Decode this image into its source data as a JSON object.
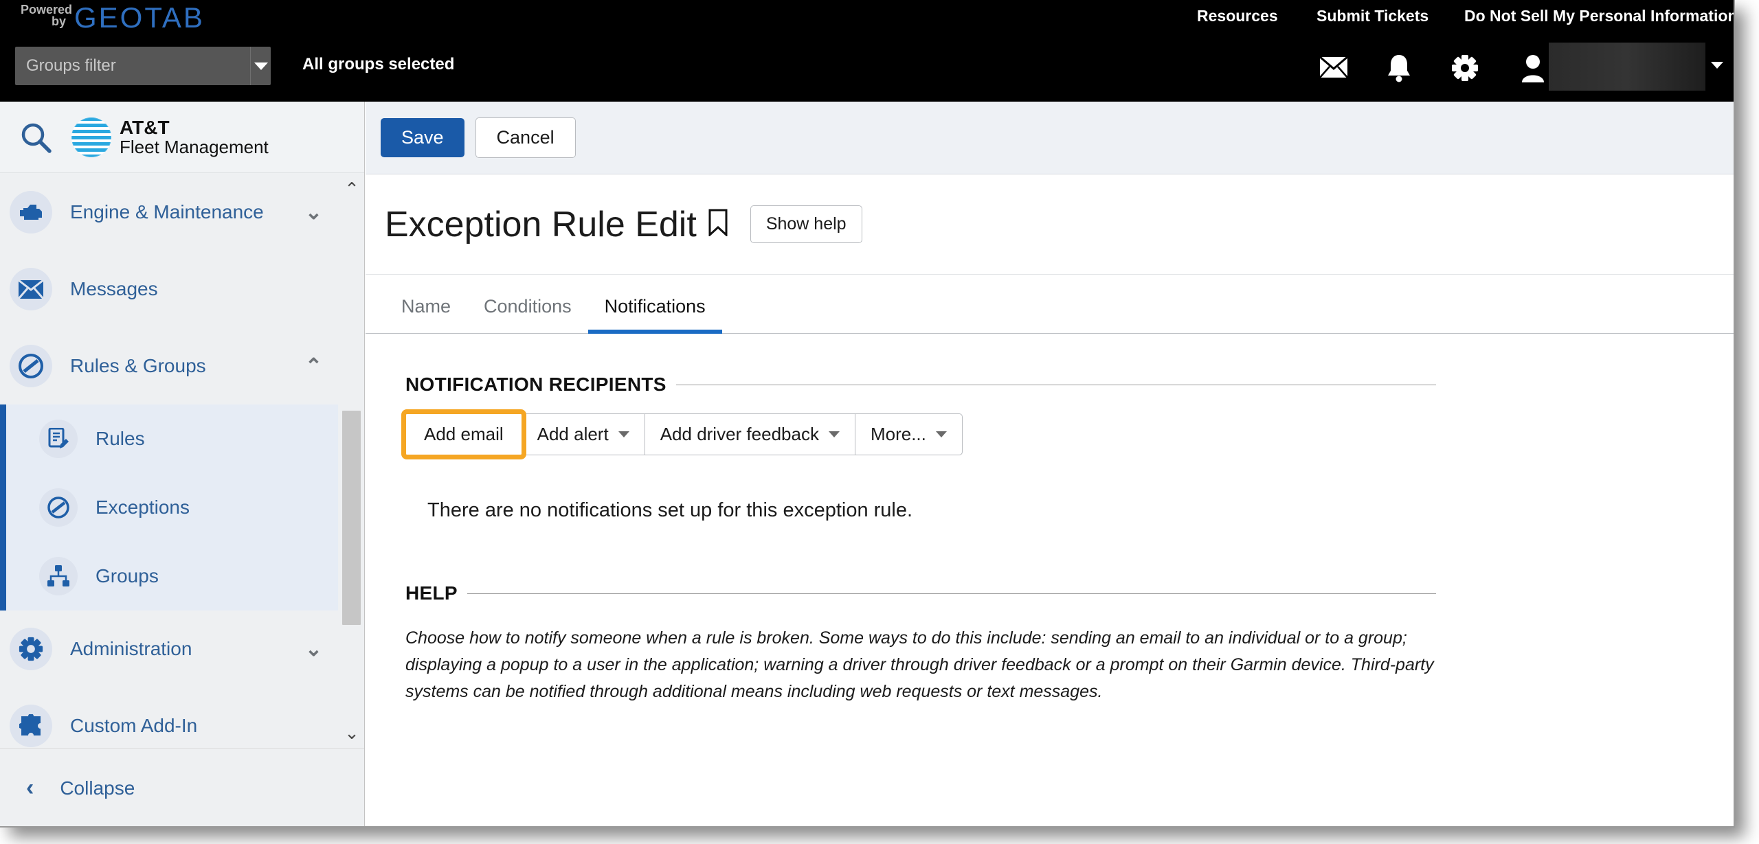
{
  "topbar": {
    "powered_by": "Powered by",
    "brand": "GEOTAB",
    "links": [
      {
        "label": "Resources"
      },
      {
        "label": "Submit Tickets"
      },
      {
        "label": "Do Not Sell My Personal Information"
      }
    ],
    "groups_filter_placeholder": "Groups filter",
    "groups_filter_value": "",
    "groups_status": "All groups selected",
    "icons": {
      "mail": "✉",
      "bell": "🔔",
      "gear": "✷",
      "user": "👤"
    },
    "user_name_redacted": ""
  },
  "sidebar": {
    "search_icon": "search-icon",
    "logo": {
      "name": "AT&T",
      "subtitle": "Fleet Management"
    },
    "items": [
      {
        "label": "Engine & Maintenance",
        "icon": "engine-icon",
        "chevron": "⌄"
      },
      {
        "label": "Messages",
        "icon": "envelope-icon",
        "chevron": ""
      },
      {
        "label": "Rules & Groups",
        "icon": "no-entry-icon",
        "chevron": "⌃"
      }
    ],
    "sub_items": [
      {
        "label": "Rules",
        "icon": "document-edit-icon"
      },
      {
        "label": "Exceptions",
        "icon": "no-entry-icon"
      },
      {
        "label": "Groups",
        "icon": "org-tree-icon"
      }
    ],
    "items_after": [
      {
        "label": "Administration",
        "icon": "gear-icon",
        "chevron": "⌄"
      },
      {
        "label": "Custom Add-In",
        "icon": "puzzle-icon",
        "chevron": ""
      }
    ],
    "collapse_label": "Collapse",
    "scroll_up": "⌃",
    "scroll_down": "⌄"
  },
  "main": {
    "save_label": "Save",
    "cancel_label": "Cancel",
    "page_title": "Exception Rule Edit",
    "show_help_label": "Show help",
    "tabs": [
      {
        "label": "Name",
        "active": false
      },
      {
        "label": "Conditions",
        "active": false
      },
      {
        "label": "Notifications",
        "active": true
      }
    ],
    "recipients_section_title": "NOTIFICATION RECIPIENTS",
    "recipient_buttons": [
      {
        "label": "Add email",
        "has_caret": false,
        "highlighted": true
      },
      {
        "label": "Add alert",
        "has_caret": true,
        "highlighted": false
      },
      {
        "label": "Add driver feedback",
        "has_caret": true,
        "highlighted": false
      },
      {
        "label": "More...",
        "has_caret": true,
        "highlighted": false
      }
    ],
    "empty_message": "There are no notifications set up for this exception rule.",
    "help_section_title": "HELP",
    "help_text": "Choose how to notify someone when a rule is broken. Some ways to do this include: sending an email to an individual or to a group; displaying a popup to a user in the application; warning a driver through driver feedback or a prompt on their Garmin device. Third-party systems can be notified through additional means including web requests or text messages."
  },
  "colors": {
    "accent_blue": "#1a5aa8",
    "tab_underline": "#1a6bc4",
    "highlight_orange": "#f5a623",
    "topbar_black": "#000000",
    "sidebar_bg": "#eef0f2",
    "att_cyan": "#2aa8e0"
  }
}
